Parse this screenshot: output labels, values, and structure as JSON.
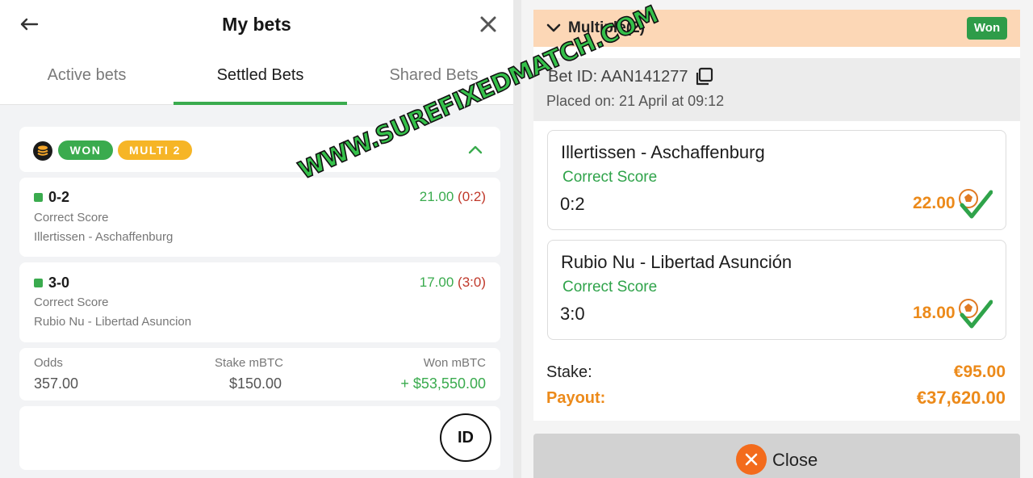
{
  "left": {
    "title": "My bets",
    "tabs": [
      "Active bets",
      "Settled Bets",
      "Shared Bets"
    ],
    "active_tab": "Settled Bets",
    "bet": {
      "status_badge": "WON",
      "type_badge": "MULTI 2",
      "selections": [
        {
          "pick": "0-2",
          "market": "Correct Score",
          "match": "Illertissen - Aschaffenburg",
          "odds": "21.00",
          "result": "(0:2)"
        },
        {
          "pick": "3-0",
          "market": "Correct Score",
          "match": "Rubio Nu - Libertad Asuncion",
          "odds": "17.00",
          "result": "(3:0)"
        }
      ],
      "summary": {
        "odds_label": "Odds",
        "odds_value": "357.00",
        "stake_label": "Stake mBTC",
        "stake_value": "$150.00",
        "won_label": "Won mBTC",
        "won_value": "+ $53,550.00"
      },
      "id_button": "ID"
    }
  },
  "right": {
    "header_label": "Multiple(2)",
    "status_badge": "Won",
    "bet_id": "Bet ID: AAN141277",
    "placed": "Placed on: 21 April at 09:12",
    "selections": [
      {
        "match": "Illertissen - Aschaffenburg",
        "market": "Correct Score",
        "score": "0:2",
        "odds": "22.00"
      },
      {
        "match": "Rubio Nu - Libertad Asunción",
        "market": "Correct Score",
        "score": "3:0",
        "odds": "18.00"
      }
    ],
    "stake_label": "Stake:",
    "stake_value": "€95.00",
    "payout_label": "Payout:",
    "payout_value": "€37,620.00",
    "close_label": "Close"
  },
  "watermark": "WWW.SUREFIXEDMATCH.COM",
  "colors": {
    "green": "#3aab4e",
    "orange": "#ec8a1a",
    "peach": "#fcd7b6",
    "won_green": "#2e9c49",
    "loss_red": "#c0392b",
    "close_orange": "#f36b1c"
  },
  "icons": [
    "back-arrow-icon",
    "close-icon",
    "coin-stack-icon",
    "chevron-up-icon",
    "chevron-down-icon",
    "copy-icon",
    "soccer-ball-check-icon"
  ]
}
